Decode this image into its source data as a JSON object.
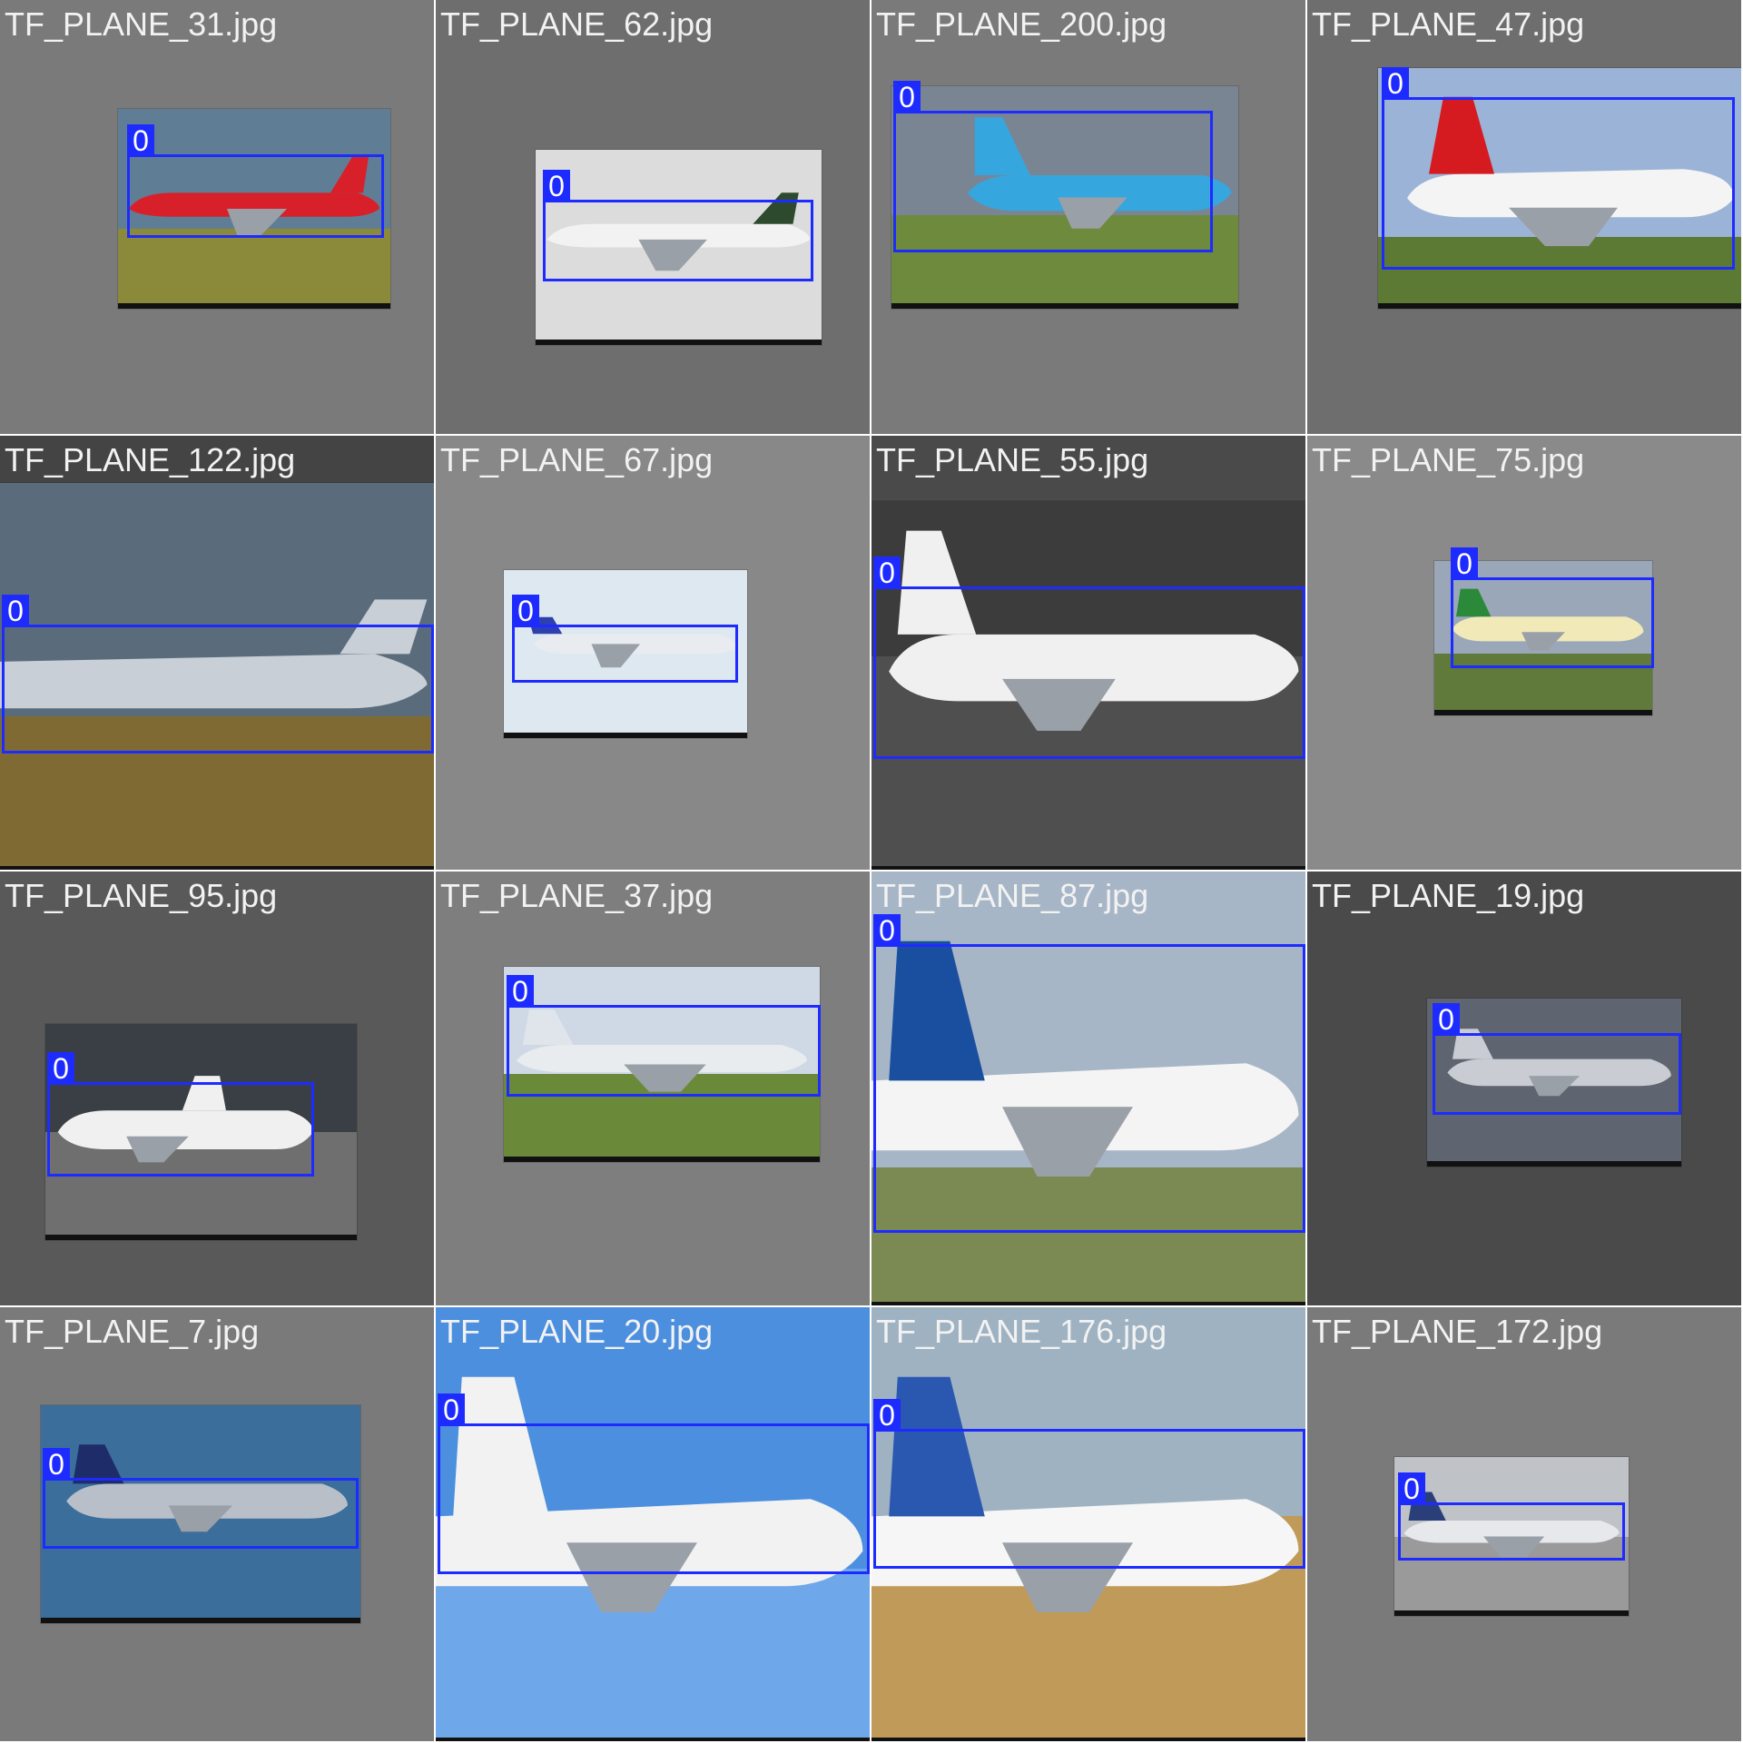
{
  "colors": {
    "box": "#1e2bff",
    "label_text": "#ffffff",
    "filename_text": "#f2f2f2",
    "grid_line": "#ffffff"
  },
  "tiles": [
    {
      "filename": "TF_PLANE_31.jpg",
      "class_label": "0",
      "bg": "#7a7a7a",
      "sky": "#5f7e95",
      "ground": "#8a8a3a",
      "fuselage": "#d8202a",
      "tail": "#d8202a"
    },
    {
      "filename": "TF_PLANE_62.jpg",
      "class_label": "0",
      "bg": "#6e6e6e",
      "sky": "#dcdcdc",
      "ground": "#cfcfcf",
      "fuselage": "#f2f2f2",
      "tail": "#2e4a2e"
    },
    {
      "filename": "TF_PLANE_200.jpg",
      "class_label": "0",
      "bg": "#7a7a7a",
      "sky": "#7a8594",
      "ground": "#6e8a3c",
      "fuselage": "#36a6df",
      "tail": "#36a6df"
    },
    {
      "filename": "TF_PLANE_47.jpg",
      "class_label": "0",
      "bg": "#6e6e6e",
      "sky": "#9bb3d6",
      "ground": "#5c7a34",
      "fuselage": "#f4f4f4",
      "tail": "#d51a20"
    },
    {
      "filename": "TF_PLANE_122.jpg",
      "class_label": "0",
      "bg": "#444444",
      "sky": "#5a6c7c",
      "ground": "#7e6a32",
      "fuselage": "#c9cfd6",
      "tail": "#c9cfd6"
    },
    {
      "filename": "TF_PLANE_67.jpg",
      "class_label": "0",
      "bg": "#888888",
      "sky": "#dde8f0",
      "ground": "#dde8f0",
      "fuselage": "#e8ecf0",
      "tail": "#2e3fb0"
    },
    {
      "filename": "TF_PLANE_55.jpg",
      "class_label": "0",
      "bg": "#4a4a4a",
      "sky": "#3c3c3c",
      "ground": "#4f4f4f",
      "fuselage": "#f0f0f0",
      "tail": "#f0f0f0"
    },
    {
      "filename": "TF_PLANE_75.jpg",
      "class_label": "0",
      "bg": "#8a8a8a",
      "sky": "#9aa7b8",
      "ground": "#5f7a3a",
      "fuselage": "#f2e9b8",
      "tail": "#2a8a3a"
    },
    {
      "filename": "TF_PLANE_95.jpg",
      "class_label": "0",
      "bg": "#595959",
      "sky": "#3a3f45",
      "ground": "#6f6f6f",
      "fuselage": "#f0f0f0",
      "tail": "#f0f0f0"
    },
    {
      "filename": "TF_PLANE_37.jpg",
      "class_label": "0",
      "bg": "#7e7e7e",
      "sky": "#cfd9e6",
      "ground": "#6a8a3a",
      "fuselage": "#e8ecee",
      "tail": "#dfe5ea"
    },
    {
      "filename": "TF_PLANE_87.jpg",
      "class_label": "0",
      "bg": "#a4b4c4",
      "sky": "#a7b6c6",
      "ground": "#7a8a52",
      "fuselage": "#f4f4f4",
      "tail": "#1a4fa0"
    },
    {
      "filename": "TF_PLANE_19.jpg",
      "class_label": "0",
      "bg": "#4a4a4a",
      "sky": "#5f6570",
      "ground": "#5f6570",
      "fuselage": "#c9ccd2",
      "tail": "#c9ccd2"
    },
    {
      "filename": "TF_PLANE_7.jpg",
      "class_label": "0",
      "bg": "#7a7a7a",
      "sky": "#3c6e9c",
      "ground": "#3c6e9c",
      "fuselage": "#b9bfc8",
      "tail": "#1e2c6a"
    },
    {
      "filename": "TF_PLANE_20.jpg",
      "class_label": "0",
      "bg": "#3b7ad0",
      "sky": "#4b8fde",
      "ground": "#6ea8ea",
      "fuselage": "#f2f2f2",
      "tail": "#f2f2f2"
    },
    {
      "filename": "TF_PLANE_176.jpg",
      "class_label": "0",
      "bg": "#8f9fae",
      "sky": "#9fb2c2",
      "ground": "#c09a58",
      "fuselage": "#f6f6f6",
      "tail": "#2a58b0"
    },
    {
      "filename": "TF_PLANE_172.jpg",
      "class_label": "0",
      "bg": "#7a7a7a",
      "sky": "#bfc2c6",
      "ground": "#9a9a9a",
      "fuselage": "#e6e8ec",
      "tail": "#2a3f7a"
    }
  ]
}
